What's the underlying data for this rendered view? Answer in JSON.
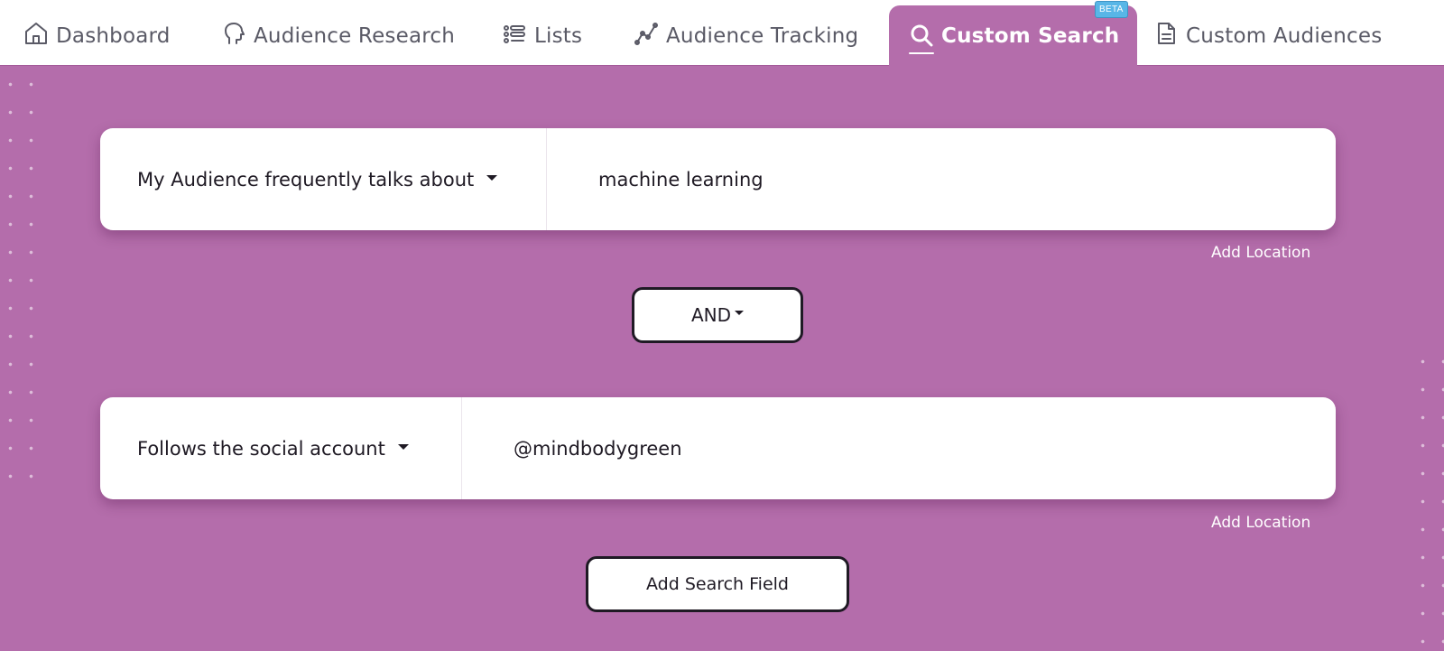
{
  "nav": {
    "items": [
      {
        "label": "Dashboard",
        "icon": "home-icon"
      },
      {
        "label": "Audience Research",
        "icon": "head-icon"
      },
      {
        "label": "Lists",
        "icon": "list-icon"
      },
      {
        "label": "Audience Tracking",
        "icon": "chart-line-icon"
      },
      {
        "label": "Custom Search",
        "icon": "search-icon",
        "active": true,
        "badge": "BETA"
      },
      {
        "label": "Custom Audiences",
        "icon": "document-icon"
      }
    ]
  },
  "search": {
    "fields": [
      {
        "condition": "My Audience frequently talks about",
        "value": "machine learning",
        "add_location": "Add Location"
      },
      {
        "condition": "Follows the social account",
        "value": "@mindbodygreen",
        "add_location": "Add Location"
      }
    ],
    "operator": "AND",
    "add_field_label": "Add Search Field"
  },
  "colors": {
    "background": "#b46dab",
    "badge": "#58b6e7",
    "text": "#1f1a24"
  }
}
